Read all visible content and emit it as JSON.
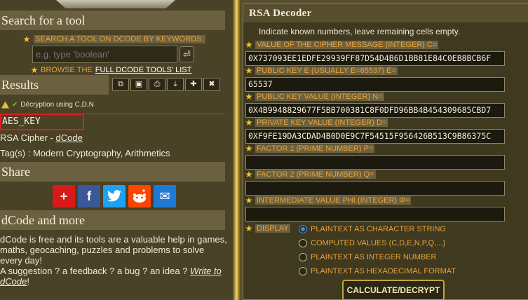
{
  "left": {
    "search_section_title": "Search for a tool",
    "search_hint": "SEARCH A TOOL ON DCODE BY KEYWORDS:",
    "search_placeholder": "e.g. type 'boolean'",
    "go_symbol": "⏎",
    "browse_prefix": "BROWSE THE",
    "browse_link": "FULL DCODE TOOLS' LIST",
    "results_title": "Results",
    "toolbar_buttons": [
      "copy-icon",
      "save-icon",
      "print-icon",
      "download-icon",
      "pin-icon",
      "close-icon"
    ],
    "decryption_note": "Décryption using C,D,N",
    "result_value": "AES_KEY",
    "cipher_name": "RSA Cipher",
    "cipher_sep": " - ",
    "cipher_link": "dCode",
    "tags": "Tag(s) : Modern Cryptography, Arithmetics",
    "share_title": "Share",
    "share_buttons": [
      "+",
      "f",
      "t",
      "r",
      "✉"
    ],
    "more_title": "dCode and more",
    "more_text": "dCode is free and its tools are a valuable help in games, maths, geocaching, puzzles and problems to solve every day!",
    "suggestion_text": "A suggestion ? a feedback ? a bug ? an idea ?",
    "write_link": "Write to dCode",
    "suggestion_end": "!"
  },
  "right": {
    "title": "RSA Decoder",
    "intro": "Indicate known numbers, leave remaining cells empty.",
    "fields": [
      {
        "label": "VALUE OF THE CIPHER MESSAGE (INTEGER) C=",
        "value": "0X737093EE1EDFE29939FF87D54D4B6D1BB81E84C0EB8BCB6F"
      },
      {
        "label": "PUBLIC KEY E (USUALLY E=65537) E=",
        "value": "65537"
      },
      {
        "label": "PUBLIC KEY VALUE (INTEGER) N=",
        "value": "0X4B9948829677F5BB700381C8F0DFD96BB4B454309685CBD7"
      },
      {
        "label": "PRIVATE KEY VALUE (INTEGER) D=",
        "value": "0XF9FE19DA3CDAD4B0D0E9C7F54515F956426B513C9B86375C"
      },
      {
        "label": "FACTOR 1 (PRIME NUMBER) P=",
        "value": ""
      },
      {
        "label": "FACTOR 2 (PRIME NUMBER) Q=",
        "value": ""
      },
      {
        "label": "INTERMEDIATE VALUE PHI (INTEGER) Φ=",
        "value": ""
      }
    ],
    "display_label": "DISPLAY",
    "display_options": [
      "PLAINTEXT AS CHARACTER STRING",
      "COMPUTED VALUES (C,D,E,N,P,Q,...)",
      "PLAINTEXT AS INTEGER NUMBER",
      "PLAINTEXT AS HEXADECIMAL FORMAT"
    ],
    "display_selected": 0,
    "submit_label": "CALCULATE/DECRYPT"
  },
  "colors": {
    "accent": "#e9a23b",
    "highlight": "#e31b1b",
    "radio": "#4a8bd6"
  }
}
